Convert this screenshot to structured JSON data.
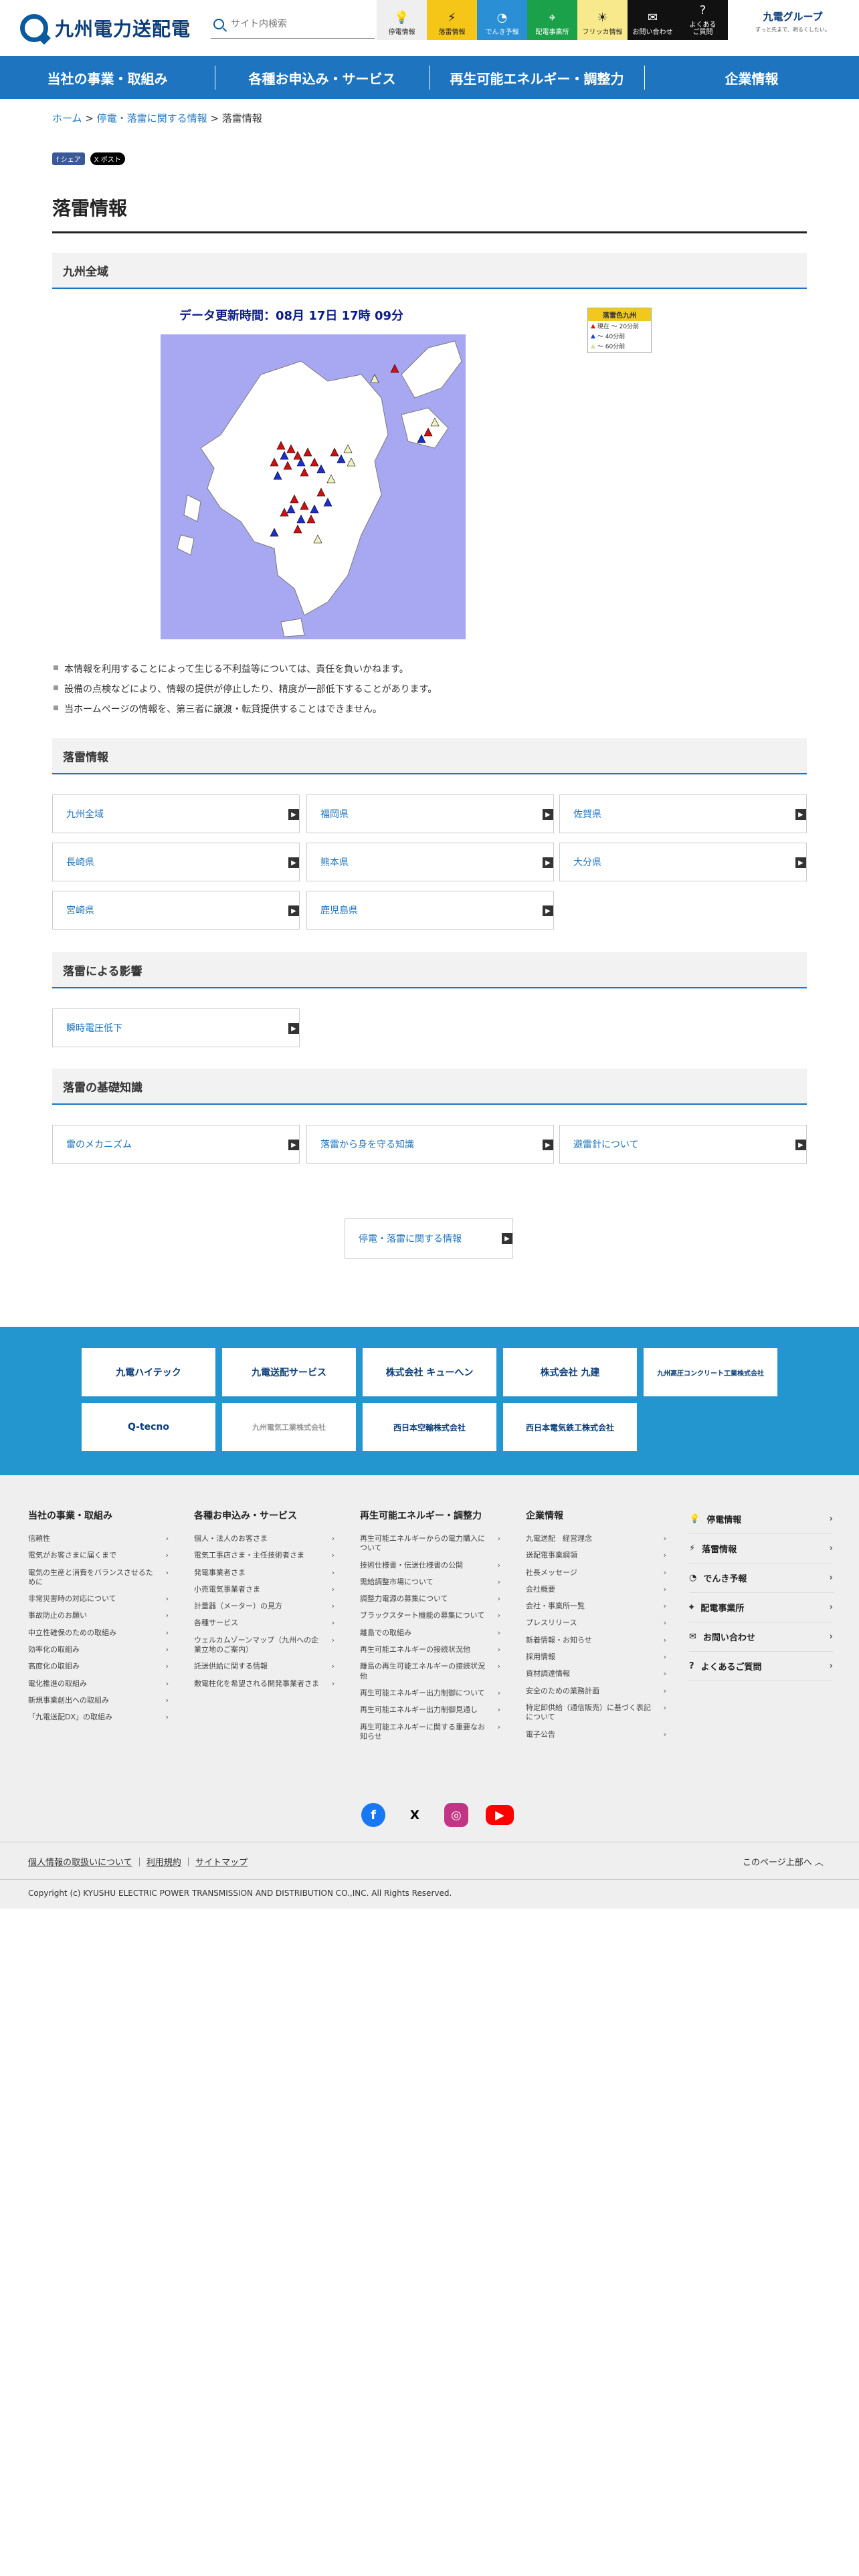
{
  "header": {
    "logo": "九州電力送配電",
    "search_placeholder": "サイト内検索",
    "quick_links": [
      {
        "label": "停電情報",
        "icon": "bulb-icon",
        "bg": "#efefef",
        "name": "qlink-outage"
      },
      {
        "label": "落雷情報",
        "icon": "lightning-icon",
        "bg": "#f5c518",
        "name": "qlink-lightning"
      },
      {
        "label": "でんき予報",
        "icon": "gauge-icon",
        "bg": "#2a8fd4",
        "name": "qlink-forecast"
      },
      {
        "label": "配電事業所",
        "icon": "pin-icon",
        "bg": "#1aa14a",
        "name": "qlink-office"
      },
      {
        "label": "フリッカ情報",
        "icon": "flicker-icon",
        "bg": "#f8ea8c",
        "name": "qlink-flicker"
      },
      {
        "label": "お問い合わせ",
        "icon": "mail-icon",
        "bg": "#111111",
        "name": "qlink-contact"
      },
      {
        "label": "よくある\nご質問",
        "icon": "question-icon",
        "bg": "#111111",
        "name": "qlink-faq"
      }
    ],
    "group_logo": "九電グループ",
    "group_tagline": "ずっと先まで、明るくしたい。"
  },
  "nav": [
    "当社の事業・取組み",
    "各種お申込み・サービス",
    "再生可能エネルギー・調整力",
    "企業情報"
  ],
  "breadcrumb": {
    "home": "ホーム",
    "parent": "停電・落雷に関する情報",
    "current": "落雷情報"
  },
  "share": {
    "facebook": "シェア",
    "x": "ポスト"
  },
  "page_title": "落雷情報",
  "region_section": {
    "title": "九州全域",
    "updated": "データ更新時間：08月 17日 17時 09分",
    "legend_title": "落雷色九州",
    "legend": [
      {
        "label": "現在 ～ 20分前",
        "color": "#e01010"
      },
      {
        "label": "～ 40分前",
        "color": "#2040d0"
      },
      {
        "label": "～ 60分前",
        "color": "#e8e8b0"
      }
    ]
  },
  "notes": [
    "本情報を利用することによって生じる不利益等については、責任を負いかねます。",
    "設備の点検などにより、情報の提供が停止したり、精度が一部低下することがあります。",
    "当ホームページの情報を、第三者に譲渡・転貸提供することはできません。"
  ],
  "lightning_section": {
    "title": "落雷情報",
    "items": [
      "九州全域",
      "福岡県",
      "佐賀県",
      "長崎県",
      "熊本県",
      "大分県",
      "宮崎県",
      "鹿児島県"
    ]
  },
  "impact_section": {
    "title": "落雷による影響",
    "items": [
      "瞬時電圧低下"
    ]
  },
  "basics_section": {
    "title": "落雷の基礎知識",
    "items": [
      "雷のメカニズム",
      "落雷から身を守る知識",
      "避雷針について"
    ]
  },
  "related_link": "停電・落雷に関する情報",
  "banners": [
    "九電ハイテック",
    "九電送配サービス",
    "株式会社 キューへン",
    "株式会社 九建",
    "九州高圧コンクリート工業株式会社",
    "Q-tecno",
    "九州電気工業株式会社",
    "西日本空輸株式会社",
    "西日本電気鉄工株式会社"
  ],
  "footer": {
    "columns": [
      {
        "title": "当社の事業・取組み",
        "items": [
          "信頼性",
          "電気がお客さまに届くまで",
          "電気の生産と消費をバランスさせるために",
          "非常災害時の対応について",
          "事故防止のお願い",
          "中立性確保のための取組み",
          "効率化の取組み",
          "高度化の取組み",
          "電化推進の取組み",
          "新規事業創出への取組み",
          "「九電送配DX」の取組み"
        ]
      },
      {
        "title": "各種お申込み・サービス",
        "items": [
          "個人・法人のお客さま",
          "電気工事店さま・主任技術者さま",
          "発電事業者さま",
          "小売電気事業者さま",
          "計量器（メーター）の見方",
          "各種サービス",
          "ウェルカムゾーンマップ（九州への企業立地のご案内）",
          "託送供給に関する情報",
          "敷電柱化を希望される開発事業者さま"
        ]
      },
      {
        "title": "再生可能エネルギー・調整力",
        "items": [
          "再生可能エネルギーからの電力購入について",
          "技術仕様書・伝送仕様書の公開",
          "需給調整市場について",
          "調整力電源の募集について",
          "ブラックスタート機能の募集について",
          "離島での取組み",
          "再生可能エネルギーの接続状況他",
          "離島の再生可能エネルギーの接続状況 他",
          "再生可能エネルギー出力制御について",
          "再生可能エネルギー出力制御見通し",
          "再生可能エネルギーに関する重要なお知らせ"
        ]
      },
      {
        "title": "企業情報",
        "items": [
          "九電送配　経営理念",
          "送配電事業綱領",
          "社長メッセージ",
          "会社概要",
          "会社・事業所一覧",
          "プレスリリース",
          "新着情報・お知らせ",
          "採用情報",
          "資材調達情報",
          "安全のための業務計画",
          "特定卸供給（通信販売）に基づく表記について",
          "電子公告"
        ]
      }
    ],
    "quick": [
      {
        "label": "停電情報",
        "icon": "bulb-icon"
      },
      {
        "label": "落雷情報",
        "icon": "lightning-icon"
      },
      {
        "label": "でんき予報",
        "icon": "gauge-icon"
      },
      {
        "label": "配電事業所",
        "icon": "pin-icon"
      },
      {
        "label": "お問い合わせ",
        "icon": "mail-icon"
      },
      {
        "label": "よくあるご質問",
        "icon": "question-icon"
      }
    ],
    "links": [
      "個人情報の取扱いについて",
      "利用規約",
      "サイトマップ"
    ],
    "pagetop": "このページ上部へ",
    "copyright": "Copyright (c) KYUSHU ELECTRIC POWER TRANSMISSION AND DISTRIBUTION CO.,INC. All Rights Reserved."
  }
}
